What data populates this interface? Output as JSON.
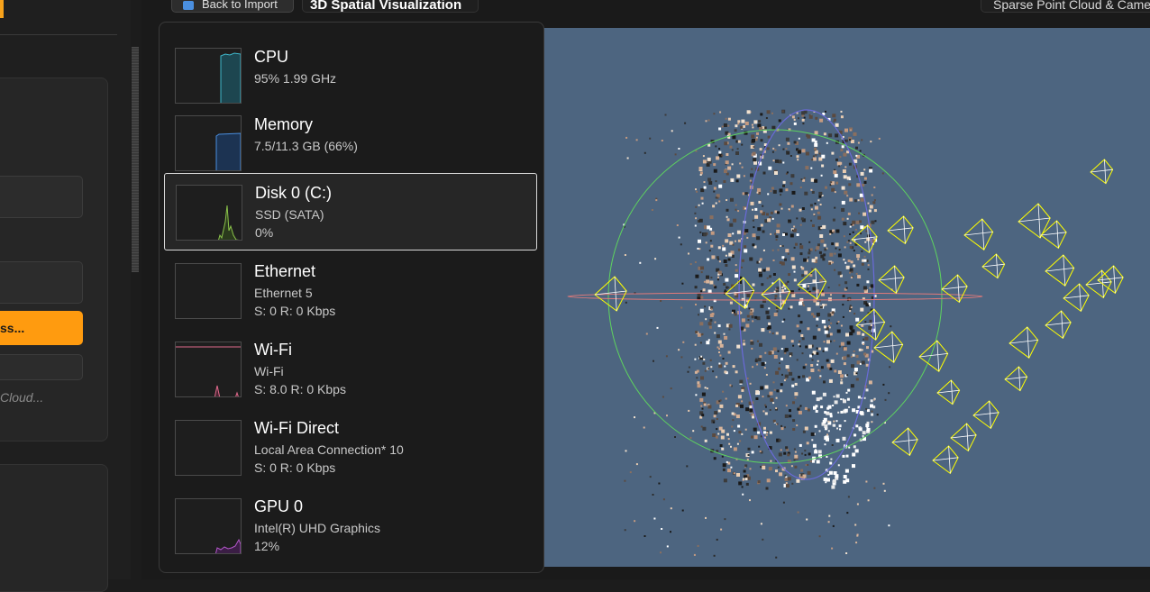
{
  "left_panel": {
    "process_button": "ss...",
    "cloud_label": "Cloud..."
  },
  "header": {
    "back_button": "Back to Import",
    "title": "3D Spatial Visualization",
    "right_tab": "Sparse Point Cloud & Cameras"
  },
  "task_manager": {
    "items": [
      {
        "name": "CPU",
        "line1": "95%  1.99 GHz",
        "line2": "",
        "graph_color": "#3fb6c9"
      },
      {
        "name": "Memory",
        "line1": "7.5/11.3 GB (66%)",
        "line2": "",
        "graph_color": "#4a8fe0"
      },
      {
        "name": "Disk 0 (C:)",
        "line1": "SSD (SATA)",
        "line2": "0%",
        "graph_color": "#8bc34a",
        "selected": true
      },
      {
        "name": "Ethernet",
        "line1": "Ethernet 5",
        "line2": "S: 0 R: 0 Kbps",
        "graph_color": "#c87941"
      },
      {
        "name": "Wi-Fi",
        "line1": "Wi-Fi",
        "line2": "S: 8.0 R: 0 Kbps",
        "graph_color": "#e06a8c"
      },
      {
        "name": "Wi-Fi Direct",
        "line1": "Local Area Connection* 10",
        "line2": "S: 0 R: 0 Kbps",
        "graph_color": "#c87941"
      },
      {
        "name": "GPU 0",
        "line1": "Intel(R) UHD Graphics",
        "line2": "12%",
        "graph_color": "#b356c9"
      }
    ]
  },
  "viewport": {
    "background": "#4d6580",
    "sphere_colors": {
      "equator": "#5ed35e",
      "meridian": "#6a6ad8",
      "horizontal": "#e07a7a"
    },
    "camera_color": "#ffff00"
  }
}
